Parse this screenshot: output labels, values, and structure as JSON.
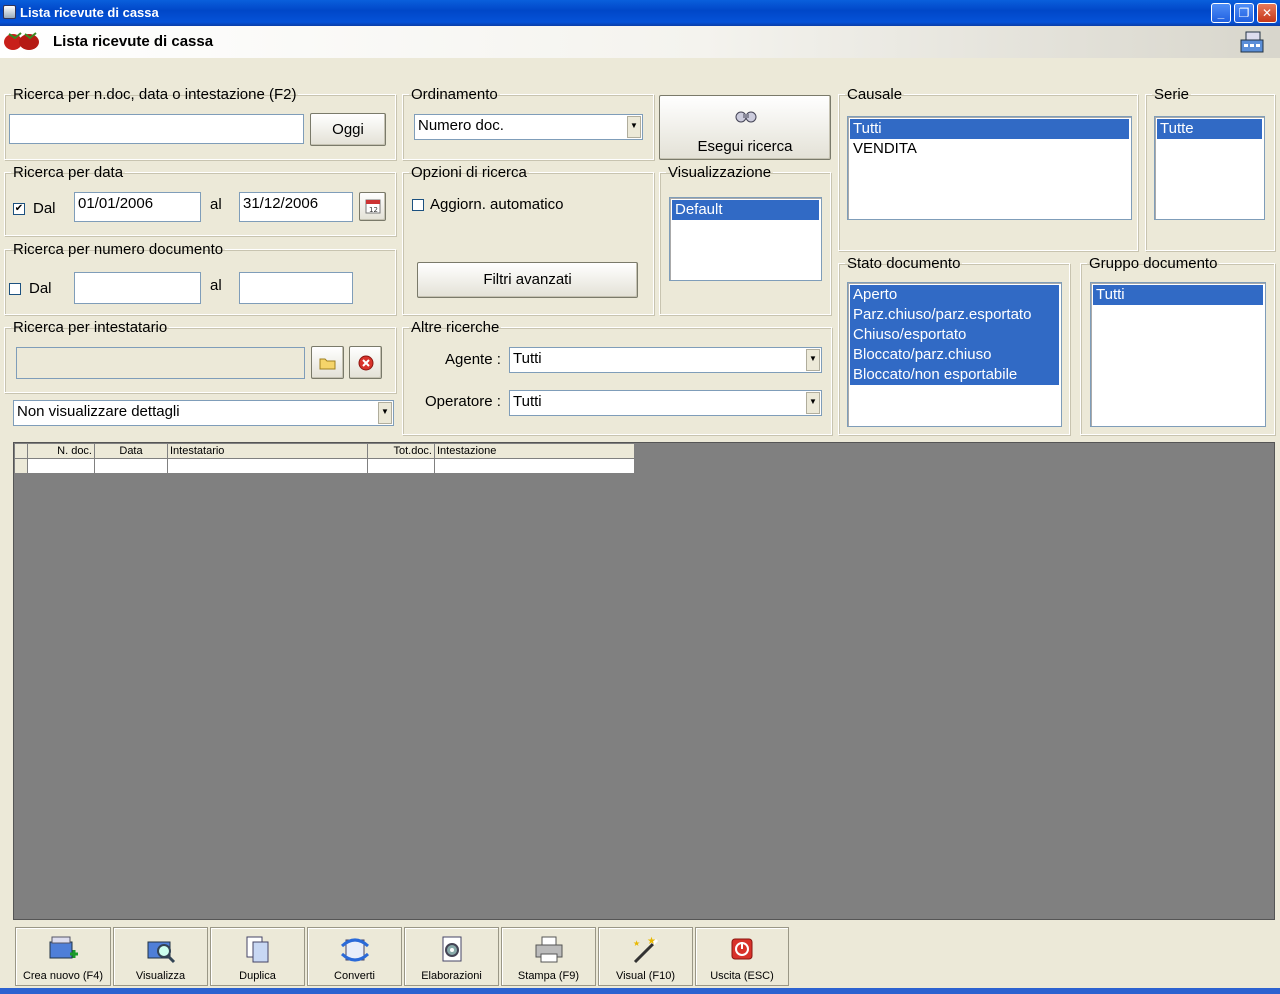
{
  "window": {
    "title": "Lista ricevute di cassa"
  },
  "header": {
    "title": "Lista ricevute di cassa"
  },
  "search_main": {
    "legend": "Ricerca per n.doc, data o intestazione (F2)",
    "value": "",
    "today_button": "Oggi"
  },
  "search_date": {
    "legend": "Ricerca per data",
    "from_label": "Dal",
    "from_checked": true,
    "from_value": "01/01/2006",
    "to_label": "al",
    "to_value": "31/12/2006"
  },
  "search_number": {
    "legend": "Ricerca per numero documento",
    "from_label": "Dal",
    "from_checked": false,
    "from_value": "",
    "to_label": "al",
    "to_value": ""
  },
  "search_holder": {
    "legend": "Ricerca per intestatario",
    "value": ""
  },
  "details_combo": {
    "value": "Non visualizzare dettagli"
  },
  "sorting": {
    "legend": "Ordinamento",
    "value": "Numero doc."
  },
  "search_button": {
    "label": "Esegui ricerca"
  },
  "search_options": {
    "legend": "Opzioni di ricerca",
    "auto_update_label": "Aggiorn. automatico",
    "auto_update_checked": false,
    "advanced_filters_button": "Filtri avanzati"
  },
  "view": {
    "legend": "Visualizzazione",
    "items": [
      {
        "label": "Default",
        "selected": true
      }
    ]
  },
  "other_searches": {
    "legend": "Altre ricerche",
    "agent_label": "Agente :",
    "agent_value": "Tutti",
    "operator_label": "Operatore :",
    "operator_value": "Tutti"
  },
  "causale": {
    "legend": "Causale",
    "items": [
      {
        "label": "Tutti",
        "selected": true
      },
      {
        "label": "VENDITA",
        "selected": false
      }
    ]
  },
  "serie": {
    "legend": "Serie",
    "items": [
      {
        "label": "Tutte",
        "selected": true
      }
    ]
  },
  "doc_state": {
    "legend": "Stato documento",
    "items": [
      {
        "label": "Aperto",
        "selected": true
      },
      {
        "label": "Parz.chiuso/parz.esportato",
        "selected": true
      },
      {
        "label": "Chiuso/esportato",
        "selected": true
      },
      {
        "label": "Bloccato/parz.chiuso",
        "selected": true
      },
      {
        "label": "Bloccato/non esportabile",
        "selected": true
      }
    ]
  },
  "doc_group": {
    "legend": "Gruppo documento",
    "items": [
      {
        "label": "Tutti",
        "selected": true
      }
    ]
  },
  "grid": {
    "columns": [
      "",
      "N. doc.",
      "Data",
      "Intestatario",
      "Tot.doc.",
      "Intestazione"
    ]
  },
  "toolbar": {
    "buttons": [
      {
        "label": "Crea nuovo (F4)",
        "icon": "new-document-icon"
      },
      {
        "label": "Visualizza",
        "icon": "view-icon"
      },
      {
        "label": "Duplica",
        "icon": "duplicate-icon"
      },
      {
        "label": "Converti",
        "icon": "convert-icon"
      },
      {
        "label": "Elaborazioni",
        "icon": "processing-icon"
      },
      {
        "label": "Stampa (F9)",
        "icon": "printer-icon"
      },
      {
        "label": "Visual (F10)",
        "icon": "magic-wand-icon"
      },
      {
        "label": "Uscita (ESC)",
        "icon": "exit-icon"
      }
    ]
  }
}
